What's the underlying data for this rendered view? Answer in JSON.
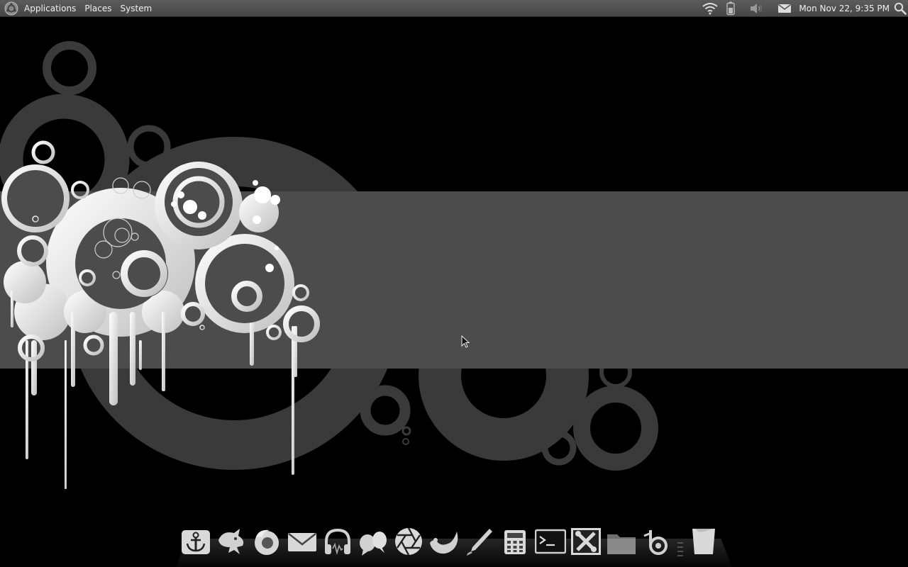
{
  "top_panel": {
    "menus": [
      "Applications",
      "Places",
      "System"
    ],
    "tray_icons": [
      "wifi-icon",
      "battery-icon",
      "volume-icon",
      "mail-icon"
    ],
    "clock": "Mon Nov 22,  9:35 PM",
    "search_icon": "search-icon"
  },
  "dock": {
    "items": [
      {
        "name": "anchor-launcher",
        "icon": "anchor-icon"
      },
      {
        "name": "pidgin-launcher",
        "icon": "bird-icon"
      },
      {
        "name": "firefox-launcher",
        "icon": "firefox-icon"
      },
      {
        "name": "mail-launcher",
        "icon": "envelope-icon"
      },
      {
        "name": "music-launcher",
        "icon": "headphones-icon"
      },
      {
        "name": "chat-launcher",
        "icon": "speech-bubbles-icon"
      },
      {
        "name": "camera-launcher",
        "icon": "aperture-icon"
      },
      {
        "name": "gimp-launcher",
        "icon": "gimp-icon"
      },
      {
        "name": "inkscape-launcher",
        "icon": "pen-icon"
      },
      {
        "name": "calculator-launcher",
        "icon": "calculator-icon"
      },
      {
        "name": "terminal-launcher",
        "icon": "terminal-icon"
      },
      {
        "name": "settings-launcher",
        "icon": "tools-icon"
      },
      {
        "name": "files-launcher",
        "icon": "folder-icon"
      },
      {
        "name": "blender-launcher",
        "icon": "blender-icon"
      },
      {
        "name": "trash-launcher",
        "icon": "trash-icon"
      }
    ]
  },
  "colors": {
    "panel": "#4f4f4f",
    "wallpaper_band": "#4c4c4c",
    "wallpaper_rings": "#3a3a3a",
    "wallpaper_splash": "#e0e0e0"
  }
}
